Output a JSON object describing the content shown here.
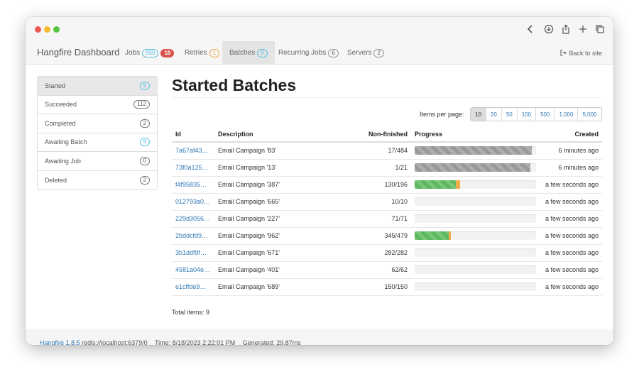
{
  "brand": "Hangfire Dashboard",
  "nav": {
    "jobs": {
      "label": "Jobs",
      "count": "950",
      "failed": "18"
    },
    "retries": {
      "label": "Retries",
      "count": "1"
    },
    "batches": {
      "label": "Batches",
      "count": "9"
    },
    "recurring": {
      "label": "Recurring Jobs",
      "count": "6"
    },
    "servers": {
      "label": "Servers",
      "count": "2"
    },
    "back": "Back to site"
  },
  "sidebar": [
    {
      "label": "Started",
      "count": "9"
    },
    {
      "label": "Succeeded",
      "count": "112"
    },
    {
      "label": "Completed",
      "count": "2"
    },
    {
      "label": "Awaiting Batch",
      "count": "9"
    },
    {
      "label": "Awaiting Job",
      "count": "0"
    },
    {
      "label": "Deleted",
      "count": "2"
    }
  ],
  "page_title": "Started Batches",
  "items_per_page_label": "Items per page:",
  "page_sizes": [
    "10",
    "20",
    "50",
    "100",
    "500",
    "1,000",
    "5,000"
  ],
  "table": {
    "headers": {
      "id": "Id",
      "description": "Description",
      "nonfinished": "Non-finished",
      "progress": "Progress",
      "created": "Created"
    },
    "rows": [
      {
        "id": "7a67af43…",
        "description": "Email Campaign '83'",
        "nonfinished": "17/484",
        "created": "6 minutes ago",
        "progress": {
          "gray": 0.965,
          "green": 0,
          "orange": 0
        }
      },
      {
        "id": "73f0a125…",
        "description": "Email Campaign '13'",
        "nonfinished": "1/21",
        "created": "6 minutes ago",
        "progress": {
          "gray": 0.952,
          "green": 0,
          "orange": 0
        }
      },
      {
        "id": "f4f95835…",
        "description": "Email Campaign '387'",
        "nonfinished": "130/196",
        "created": "a few seconds ago",
        "progress": {
          "gray": 0,
          "green": 0.337,
          "orange": 0.04
        }
      },
      {
        "id": "012793a0…",
        "description": "Email Campaign '665'",
        "nonfinished": "10/10",
        "created": "a few seconds ago",
        "progress": {
          "gray": 0,
          "green": 0,
          "orange": 0
        }
      },
      {
        "id": "229d3056…",
        "description": "Email Campaign '227'",
        "nonfinished": "71/71",
        "created": "a few seconds ago",
        "progress": {
          "gray": 0,
          "green": 0,
          "orange": 0
        }
      },
      {
        "id": "2bddcfd9…",
        "description": "Email Campaign '962'",
        "nonfinished": "345/479",
        "created": "a few seconds ago",
        "progress": {
          "gray": 0,
          "green": 0.28,
          "orange": 0.02
        }
      },
      {
        "id": "3b1ddf9f…",
        "description": "Email Campaign '671'",
        "nonfinished": "282/282",
        "created": "a few seconds ago",
        "progress": {
          "gray": 0,
          "green": 0,
          "orange": 0
        }
      },
      {
        "id": "4581a04e…",
        "description": "Email Campaign '401'",
        "nonfinished": "62/62",
        "created": "a few seconds ago",
        "progress": {
          "gray": 0,
          "green": 0,
          "orange": 0
        }
      },
      {
        "id": "e1cffde9…",
        "description": "Email Campaign '689'",
        "nonfinished": "150/150",
        "created": "a few seconds ago",
        "progress": {
          "gray": 0,
          "green": 0,
          "orange": 0
        }
      }
    ]
  },
  "total_items": "Total items: 9",
  "footer": {
    "version": "Hangfire 1.8.5",
    "storage": "redis://localhost:6379/0",
    "time": "Time: 8/18/2023 2:22:01 PM",
    "generated": "Generated: 29.87ms"
  },
  "icons": {
    "back": "chevron-left-icon",
    "download": "download-icon",
    "share": "share-icon",
    "new_tab": "plus-icon",
    "tabs": "tabs-icon",
    "sign_out": "sign-out-icon"
  },
  "colors": {
    "gray": "#999999",
    "green": "#5cb85c",
    "orange": "#f0ad4e",
    "link": "#337ab7",
    "danger": "#d9534f",
    "info": "#5bc0de"
  }
}
